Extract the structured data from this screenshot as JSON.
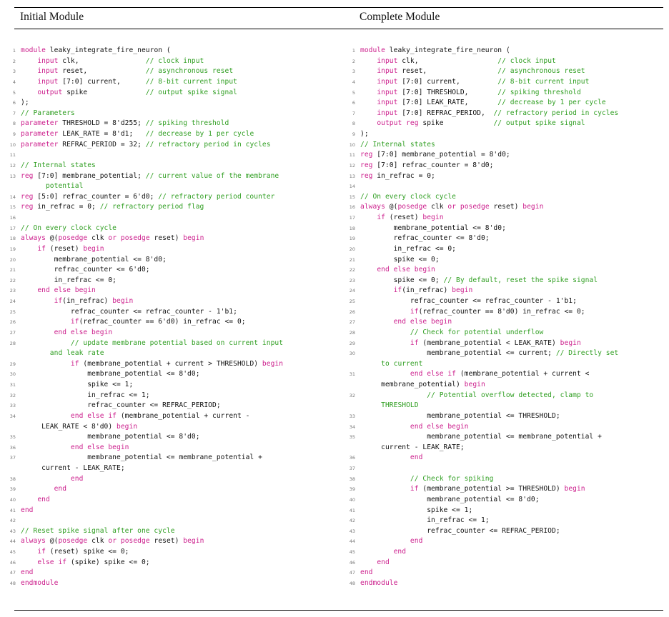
{
  "headers": {
    "left": "Initial Module",
    "right": "Complete Module"
  },
  "colors": {
    "keyword": "#cc1e8c",
    "comment": "#2f9e21",
    "text": "#111111",
    "line_number": "#777777"
  },
  "left_lines": [
    {
      "n": "1",
      "s": [
        [
          "k",
          "module"
        ],
        [
          "t",
          " leaky_integrate_fire_neuron ("
        ]
      ]
    },
    {
      "n": "2",
      "s": [
        [
          "t",
          "    "
        ],
        [
          "k",
          "input"
        ],
        [
          "t",
          " clk,                "
        ],
        [
          "c",
          "// clock input"
        ]
      ]
    },
    {
      "n": "3",
      "s": [
        [
          "t",
          "    "
        ],
        [
          "k",
          "input"
        ],
        [
          "t",
          " reset,              "
        ],
        [
          "c",
          "// asynchronous reset"
        ]
      ]
    },
    {
      "n": "4",
      "s": [
        [
          "t",
          "    "
        ],
        [
          "k",
          "input"
        ],
        [
          "t",
          " [7:0] current,      "
        ],
        [
          "c",
          "// 8-bit current input"
        ]
      ]
    },
    {
      "n": "5",
      "s": [
        [
          "t",
          "    "
        ],
        [
          "k",
          "output"
        ],
        [
          "t",
          " spike              "
        ],
        [
          "c",
          "// output spike signal"
        ]
      ]
    },
    {
      "n": "6",
      "s": [
        [
          "t",
          ");"
        ]
      ]
    },
    {
      "n": "7",
      "s": [
        [
          "c",
          "// Parameters"
        ]
      ]
    },
    {
      "n": "8",
      "s": [
        [
          "k",
          "parameter"
        ],
        [
          "t",
          " THRESHOLD = 8'd255; "
        ],
        [
          "c",
          "// spiking threshold"
        ]
      ]
    },
    {
      "n": "9",
      "s": [
        [
          "k",
          "parameter"
        ],
        [
          "t",
          " LEAK_RATE = 8'd1;   "
        ],
        [
          "c",
          "// decrease by 1 per cycle"
        ]
      ]
    },
    {
      "n": "10",
      "s": [
        [
          "k",
          "parameter"
        ],
        [
          "t",
          " REFRAC_PERIOD = 32; "
        ],
        [
          "c",
          "// refractory period in cycles"
        ]
      ]
    },
    {
      "n": "11",
      "s": []
    },
    {
      "n": "12",
      "s": [
        [
          "c",
          "// Internal states"
        ]
      ]
    },
    {
      "n": "13",
      "s": [
        [
          "k",
          "reg"
        ],
        [
          "t",
          " [7:0] membrane_potential; "
        ],
        [
          "c",
          "// current value of the membrane\n      potential"
        ]
      ]
    },
    {
      "n": "14",
      "s": [
        [
          "k",
          "reg"
        ],
        [
          "t",
          " [5:0] refrac_counter = 6'd0; "
        ],
        [
          "c",
          "// refractory period counter"
        ]
      ]
    },
    {
      "n": "15",
      "s": [
        [
          "k",
          "reg"
        ],
        [
          "t",
          " in_refrac = 0; "
        ],
        [
          "c",
          "// refractory period flag"
        ]
      ]
    },
    {
      "n": "16",
      "s": []
    },
    {
      "n": "17",
      "s": [
        [
          "c",
          "// On every clock cycle"
        ]
      ]
    },
    {
      "n": "18",
      "s": [
        [
          "k",
          "always"
        ],
        [
          "t",
          " @("
        ],
        [
          "k",
          "posedge"
        ],
        [
          "t",
          " clk "
        ],
        [
          "k",
          "or"
        ],
        [
          "t",
          " "
        ],
        [
          "k",
          "posedge"
        ],
        [
          "t",
          " reset) "
        ],
        [
          "k",
          "begin"
        ]
      ]
    },
    {
      "n": "19",
      "s": [
        [
          "t",
          "    "
        ],
        [
          "k",
          "if"
        ],
        [
          "t",
          " (reset) "
        ],
        [
          "k",
          "begin"
        ]
      ]
    },
    {
      "n": "20",
      "s": [
        [
          "t",
          "        membrane_potential <= 8'd0;"
        ]
      ]
    },
    {
      "n": "21",
      "s": [
        [
          "t",
          "        refrac_counter <= 6'd0;"
        ]
      ]
    },
    {
      "n": "22",
      "s": [
        [
          "t",
          "        in_refrac <= 0;"
        ]
      ]
    },
    {
      "n": "23",
      "s": [
        [
          "t",
          "    "
        ],
        [
          "k",
          "end else begin"
        ]
      ]
    },
    {
      "n": "24",
      "s": [
        [
          "t",
          "        "
        ],
        [
          "k",
          "if"
        ],
        [
          "t",
          "(in_refrac) "
        ],
        [
          "k",
          "begin"
        ]
      ]
    },
    {
      "n": "25",
      "s": [
        [
          "t",
          "            refrac_counter <= refrac_counter - 1'b1;"
        ]
      ]
    },
    {
      "n": "26",
      "s": [
        [
          "t",
          "            "
        ],
        [
          "k",
          "if"
        ],
        [
          "t",
          "(refrac_counter == 6'd0) in_refrac <= 0;"
        ]
      ]
    },
    {
      "n": "27",
      "s": [
        [
          "t",
          "        "
        ],
        [
          "k",
          "end else begin"
        ]
      ]
    },
    {
      "n": "28",
      "s": [
        [
          "t",
          "            "
        ],
        [
          "c",
          "// update membrane potential based on current input\n       and leak rate"
        ]
      ]
    },
    {
      "n": "29",
      "s": [
        [
          "t",
          "            "
        ],
        [
          "k",
          "if"
        ],
        [
          "t",
          " (membrane_potential + current > THRESHOLD) "
        ],
        [
          "k",
          "begin"
        ]
      ]
    },
    {
      "n": "30",
      "s": [
        [
          "t",
          "                membrane_potential <= 8'd0;"
        ]
      ]
    },
    {
      "n": "31",
      "s": [
        [
          "t",
          "                spike <= 1;"
        ]
      ]
    },
    {
      "n": "32",
      "s": [
        [
          "t",
          "                in_refrac <= 1;"
        ]
      ]
    },
    {
      "n": "33",
      "s": [
        [
          "t",
          "                refrac_counter <= REFRAC_PERIOD;"
        ]
      ]
    },
    {
      "n": "34",
      "s": [
        [
          "t",
          "            "
        ],
        [
          "k",
          "end else if"
        ],
        [
          "t",
          " (membrane_potential + current -\n     LEAK_RATE < 8'd0) "
        ],
        [
          "k",
          "begin"
        ]
      ]
    },
    {
      "n": "35",
      "s": [
        [
          "t",
          "                membrane_potential <= 8'd0;"
        ]
      ]
    },
    {
      "n": "36",
      "s": [
        [
          "t",
          "            "
        ],
        [
          "k",
          "end else begin"
        ]
      ]
    },
    {
      "n": "37",
      "s": [
        [
          "t",
          "                membrane_potential <= membrane_potential +\n     current - LEAK_RATE;"
        ]
      ]
    },
    {
      "n": "38",
      "s": [
        [
          "t",
          "            "
        ],
        [
          "k",
          "end"
        ]
      ]
    },
    {
      "n": "39",
      "s": [
        [
          "t",
          "        "
        ],
        [
          "k",
          "end"
        ]
      ]
    },
    {
      "n": "40",
      "s": [
        [
          "t",
          "    "
        ],
        [
          "k",
          "end"
        ]
      ]
    },
    {
      "n": "41",
      "s": [
        [
          "k",
          "end"
        ]
      ]
    },
    {
      "n": "42",
      "s": []
    },
    {
      "n": "43",
      "s": [
        [
          "c",
          "// Reset spike signal after one cycle"
        ]
      ]
    },
    {
      "n": "44",
      "s": [
        [
          "k",
          "always"
        ],
        [
          "t",
          " @("
        ],
        [
          "k",
          "posedge"
        ],
        [
          "t",
          " clk "
        ],
        [
          "k",
          "or"
        ],
        [
          "t",
          " "
        ],
        [
          "k",
          "posedge"
        ],
        [
          "t",
          " reset) "
        ],
        [
          "k",
          "begin"
        ]
      ]
    },
    {
      "n": "45",
      "s": [
        [
          "t",
          "    "
        ],
        [
          "k",
          "if"
        ],
        [
          "t",
          " (reset) spike <= 0;"
        ]
      ]
    },
    {
      "n": "46",
      "s": [
        [
          "t",
          "    "
        ],
        [
          "k",
          "else if"
        ],
        [
          "t",
          " (spike) spike <= 0;"
        ]
      ]
    },
    {
      "n": "47",
      "s": [
        [
          "k",
          "end"
        ]
      ]
    },
    {
      "n": "48",
      "s": [
        [
          "k",
          "endmodule"
        ]
      ]
    }
  ],
  "right_lines": [
    {
      "n": "1",
      "s": [
        [
          "k",
          "module"
        ],
        [
          "t",
          " leaky_integrate_fire_neuron ("
        ]
      ]
    },
    {
      "n": "2",
      "s": [
        [
          "t",
          "    "
        ],
        [
          "k",
          "input"
        ],
        [
          "t",
          " clk,                   "
        ],
        [
          "c",
          "// clock input"
        ]
      ]
    },
    {
      "n": "3",
      "s": [
        [
          "t",
          "    "
        ],
        [
          "k",
          "input"
        ],
        [
          "t",
          " reset,                 "
        ],
        [
          "c",
          "// asynchronous reset"
        ]
      ]
    },
    {
      "n": "4",
      "s": [
        [
          "t",
          "    "
        ],
        [
          "k",
          "input"
        ],
        [
          "t",
          " [7:0] current,         "
        ],
        [
          "c",
          "// 8-bit current input"
        ]
      ]
    },
    {
      "n": "5",
      "s": [
        [
          "t",
          "    "
        ],
        [
          "k",
          "input"
        ],
        [
          "t",
          " [7:0] THRESHOLD,       "
        ],
        [
          "c",
          "// spiking threshold"
        ]
      ]
    },
    {
      "n": "6",
      "s": [
        [
          "t",
          "    "
        ],
        [
          "k",
          "input"
        ],
        [
          "t",
          " [7:0] LEAK_RATE,       "
        ],
        [
          "c",
          "// decrease by 1 per cycle"
        ]
      ]
    },
    {
      "n": "7",
      "s": [
        [
          "t",
          "    "
        ],
        [
          "k",
          "input"
        ],
        [
          "t",
          " [7:0] REFRAC_PERIOD,  "
        ],
        [
          "c",
          "// refractory period in cycles"
        ]
      ]
    },
    {
      "n": "8",
      "s": [
        [
          "t",
          "    "
        ],
        [
          "k",
          "output reg"
        ],
        [
          "t",
          " spike            "
        ],
        [
          "c",
          "// output spike signal"
        ]
      ]
    },
    {
      "n": "9",
      "s": [
        [
          "t",
          ");"
        ]
      ]
    },
    {
      "n": "10",
      "s": [
        [
          "c",
          "// Internal states"
        ]
      ]
    },
    {
      "n": "11",
      "s": [
        [
          "k",
          "reg"
        ],
        [
          "t",
          " [7:0] membrane_potential = 8'd0;"
        ]
      ]
    },
    {
      "n": "12",
      "s": [
        [
          "k",
          "reg"
        ],
        [
          "t",
          " [7:0] refrac_counter = 8'd0;"
        ]
      ]
    },
    {
      "n": "13",
      "s": [
        [
          "k",
          "reg"
        ],
        [
          "t",
          " in_refrac = 0;"
        ]
      ]
    },
    {
      "n": "14",
      "s": []
    },
    {
      "n": "15",
      "s": [
        [
          "c",
          "// On every clock cycle"
        ]
      ]
    },
    {
      "n": "16",
      "s": [
        [
          "k",
          "always"
        ],
        [
          "t",
          " @("
        ],
        [
          "k",
          "posedge"
        ],
        [
          "t",
          " clk "
        ],
        [
          "k",
          "or"
        ],
        [
          "t",
          " "
        ],
        [
          "k",
          "posedge"
        ],
        [
          "t",
          " reset) "
        ],
        [
          "k",
          "begin"
        ]
      ]
    },
    {
      "n": "17",
      "s": [
        [
          "t",
          "    "
        ],
        [
          "k",
          "if"
        ],
        [
          "t",
          " (reset) "
        ],
        [
          "k",
          "begin"
        ]
      ]
    },
    {
      "n": "18",
      "s": [
        [
          "t",
          "        membrane_potential <= 8'd0;"
        ]
      ]
    },
    {
      "n": "19",
      "s": [
        [
          "t",
          "        refrac_counter <= 8'd0;"
        ]
      ]
    },
    {
      "n": "20",
      "s": [
        [
          "t",
          "        in_refrac <= 0;"
        ]
      ]
    },
    {
      "n": "21",
      "s": [
        [
          "t",
          "        spike <= 0;"
        ]
      ]
    },
    {
      "n": "22",
      "s": [
        [
          "t",
          "    "
        ],
        [
          "k",
          "end else begin"
        ]
      ]
    },
    {
      "n": "23",
      "s": [
        [
          "t",
          "        spike <= 0; "
        ],
        [
          "c",
          "// By default, reset the spike signal"
        ]
      ]
    },
    {
      "n": "24",
      "s": [
        [
          "t",
          "        "
        ],
        [
          "k",
          "if"
        ],
        [
          "t",
          "(in_refrac) "
        ],
        [
          "k",
          "begin"
        ]
      ]
    },
    {
      "n": "25",
      "s": [
        [
          "t",
          "            refrac_counter <= refrac_counter - 1'b1;"
        ]
      ]
    },
    {
      "n": "26",
      "s": [
        [
          "t",
          "            "
        ],
        [
          "k",
          "if"
        ],
        [
          "t",
          "(refrac_counter == 8'd0) in_refrac <= 0;"
        ]
      ]
    },
    {
      "n": "27",
      "s": [
        [
          "t",
          "        "
        ],
        [
          "k",
          "end else begin"
        ]
      ]
    },
    {
      "n": "28",
      "s": [
        [
          "t",
          "            "
        ],
        [
          "c",
          "// Check for potential underflow"
        ]
      ]
    },
    {
      "n": "29",
      "s": [
        [
          "t",
          "            "
        ],
        [
          "k",
          "if"
        ],
        [
          "t",
          " (membrane_potential < LEAK_RATE) "
        ],
        [
          "k",
          "begin"
        ]
      ]
    },
    {
      "n": "30",
      "s": [
        [
          "t",
          "                membrane_potential <= current; "
        ],
        [
          "c",
          "// Directly set\n     to current"
        ]
      ]
    },
    {
      "n": "31",
      "s": [
        [
          "t",
          "            "
        ],
        [
          "k",
          "end else if"
        ],
        [
          "t",
          " (membrane_potential + current <\n     membrane_potential) "
        ],
        [
          "k",
          "begin"
        ]
      ]
    },
    {
      "n": "32",
      "s": [
        [
          "t",
          "                "
        ],
        [
          "c",
          "// Potential overflow detected, clamp to\n     THRESHOLD"
        ]
      ]
    },
    {
      "n": "33",
      "s": [
        [
          "t",
          "                membrane_potential <= THRESHOLD;"
        ]
      ]
    },
    {
      "n": "34",
      "s": [
        [
          "t",
          "            "
        ],
        [
          "k",
          "end else begin"
        ]
      ]
    },
    {
      "n": "35",
      "s": [
        [
          "t",
          "                membrane_potential <= membrane_potential +\n     current - LEAK_RATE;"
        ]
      ]
    },
    {
      "n": "36",
      "s": [
        [
          "t",
          "            "
        ],
        [
          "k",
          "end"
        ]
      ]
    },
    {
      "n": "37",
      "s": []
    },
    {
      "n": "38",
      "s": [
        [
          "t",
          "            "
        ],
        [
          "c",
          "// Check for spiking"
        ]
      ]
    },
    {
      "n": "39",
      "s": [
        [
          "t",
          "            "
        ],
        [
          "k",
          "if"
        ],
        [
          "t",
          " (membrane_potential >= THRESHOLD) "
        ],
        [
          "k",
          "begin"
        ]
      ]
    },
    {
      "n": "40",
      "s": [
        [
          "t",
          "                membrane_potential <= 8'd0;"
        ]
      ]
    },
    {
      "n": "41",
      "s": [
        [
          "t",
          "                spike <= 1;"
        ]
      ]
    },
    {
      "n": "42",
      "s": [
        [
          "t",
          "                in_refrac <= 1;"
        ]
      ]
    },
    {
      "n": "43",
      "s": [
        [
          "t",
          "                refrac_counter <= REFRAC_PERIOD;"
        ]
      ]
    },
    {
      "n": "44",
      "s": [
        [
          "t",
          "            "
        ],
        [
          "k",
          "end"
        ]
      ]
    },
    {
      "n": "45",
      "s": [
        [
          "t",
          "        "
        ],
        [
          "k",
          "end"
        ]
      ]
    },
    {
      "n": "46",
      "s": [
        [
          "t",
          "    "
        ],
        [
          "k",
          "end"
        ]
      ]
    },
    {
      "n": "47",
      "s": [
        [
          "k",
          "end"
        ]
      ]
    },
    {
      "n": "48",
      "s": [
        [
          "k",
          "endmodule"
        ]
      ]
    }
  ]
}
